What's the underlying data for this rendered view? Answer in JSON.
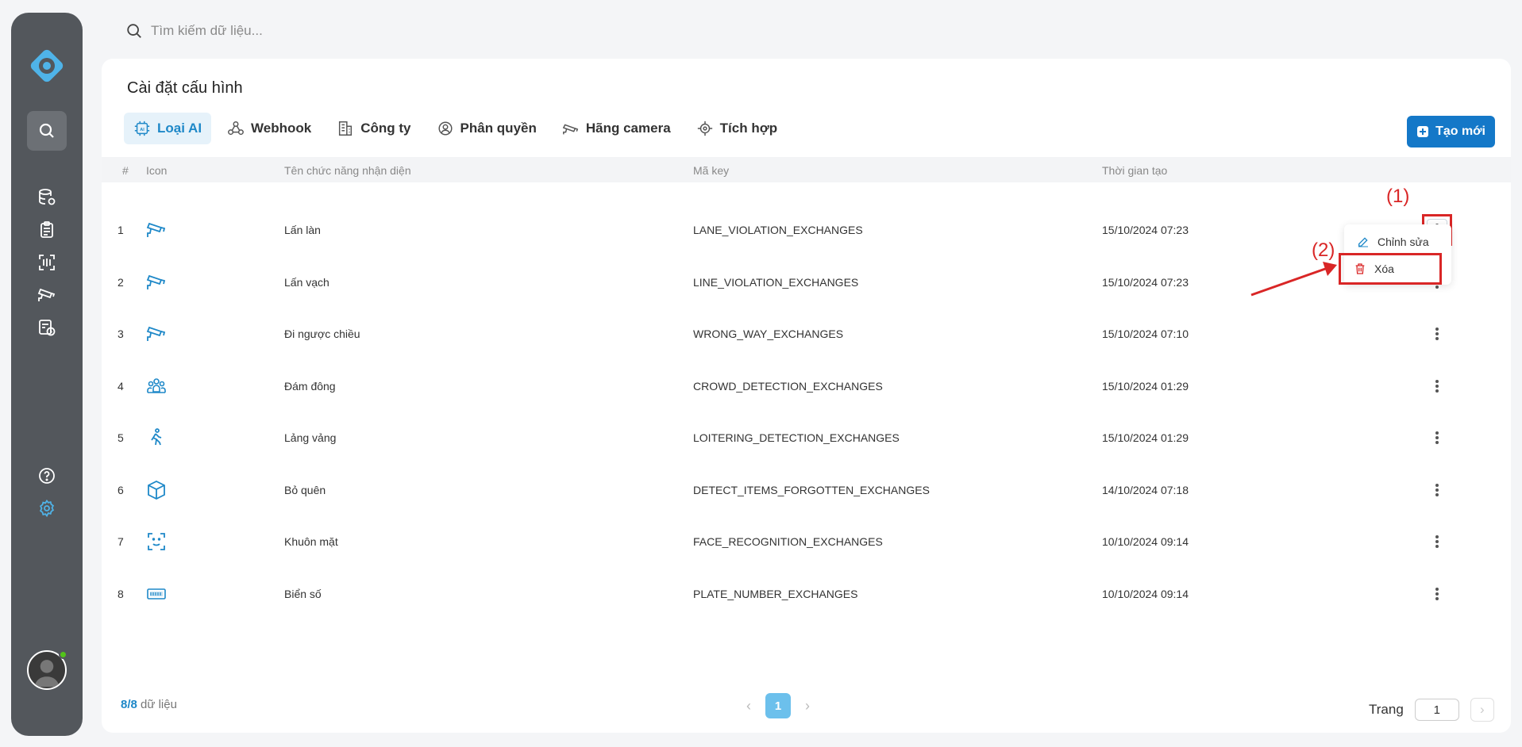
{
  "search": {
    "placeholder": "Tìm kiếm dữ liệu..."
  },
  "page": {
    "title": "Cài đặt cấu hình",
    "create_label": "Tạo mới"
  },
  "tabs": [
    {
      "label": "Loại AI",
      "icon": "ai-chip-icon"
    },
    {
      "label": "Webhook",
      "icon": "webhook-icon"
    },
    {
      "label": "Công ty",
      "icon": "building-icon"
    },
    {
      "label": "Phân quyền",
      "icon": "users-gear-icon"
    },
    {
      "label": "Hãng camera",
      "icon": "camera-icon"
    },
    {
      "label": "Tích hợp",
      "icon": "integration-icon"
    }
  ],
  "table": {
    "headers": {
      "index": "#",
      "icon": "Icon",
      "name": "Tên chức năng nhận diện",
      "key": "Mã key",
      "created": "Thời gian tạo"
    },
    "rows": [
      {
        "index": "1",
        "icon": "cctv-icon",
        "name": "Lấn làn",
        "key": "LANE_VIOLATION_EXCHANGES",
        "created": "15/10/2024 07:23"
      },
      {
        "index": "2",
        "icon": "cctv-icon",
        "name": "Lấn vạch",
        "key": "LINE_VIOLATION_EXCHANGES",
        "created": "15/10/2024 07:23"
      },
      {
        "index": "3",
        "icon": "cctv-icon",
        "name": "Đi ngược chiều",
        "key": "WRONG_WAY_EXCHANGES",
        "created": "15/10/2024 07:10"
      },
      {
        "index": "4",
        "icon": "crowd-icon",
        "name": "Đám đông",
        "key": "CROWD_DETECTION_EXCHANGES",
        "created": "15/10/2024 01:29"
      },
      {
        "index": "5",
        "icon": "walking-icon",
        "name": "Lảng vảng",
        "key": "LOITERING_DETECTION_EXCHANGES",
        "created": "15/10/2024 01:29"
      },
      {
        "index": "6",
        "icon": "box-icon",
        "name": "Bỏ quên",
        "key": "DETECT_ITEMS_FORGOTTEN_EXCHANGES",
        "created": "14/10/2024 07:18"
      },
      {
        "index": "7",
        "icon": "face-scan-icon",
        "name": "Khuôn mặt",
        "key": "FACE_RECOGNITION_EXCHANGES",
        "created": "10/10/2024 09:14"
      },
      {
        "index": "8",
        "icon": "license-plate-icon",
        "name": "Biển số",
        "key": "PLATE_NUMBER_EXCHANGES",
        "created": "10/10/2024 09:14"
      }
    ]
  },
  "dropdown": {
    "edit_label": "Chỉnh sửa",
    "delete_label": "Xóa"
  },
  "annotations": {
    "step1": "(1)",
    "step2": "(2)"
  },
  "footer": {
    "count_current": "8",
    "count_total": "/8",
    "count_suffix": " dữ liệu",
    "current_page": "1",
    "goto_label": "Trang",
    "goto_value": "1"
  },
  "colors": {
    "accent": "#1e88c8",
    "sidebar": "#53575c",
    "annotation": "#d92626"
  }
}
